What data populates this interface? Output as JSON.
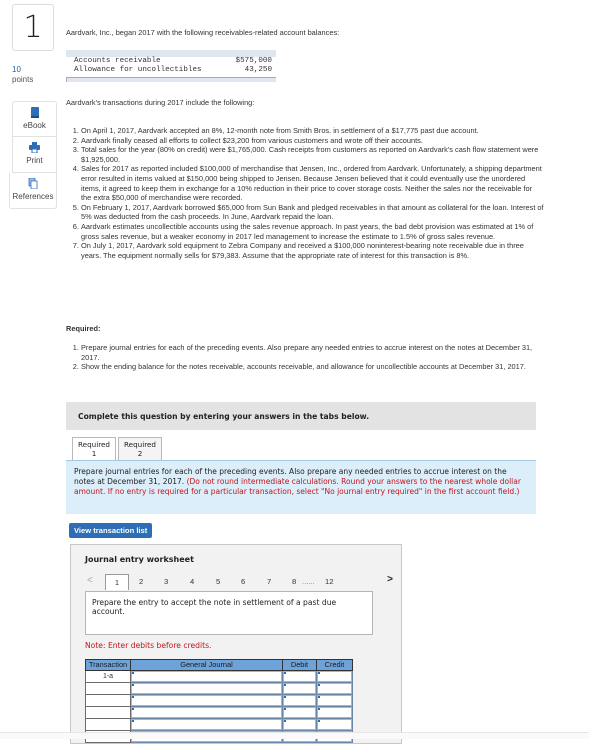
{
  "question": {
    "number": "1",
    "points_value": "10",
    "points_label": "points"
  },
  "side_tools": [
    {
      "label": "eBook",
      "icon": "book-icon"
    },
    {
      "label": "Print",
      "icon": "printer-icon"
    },
    {
      "label": "References",
      "icon": "documents-icon"
    }
  ],
  "intro": "Aardvark, Inc., began 2017 with the following receivables-related account balances:",
  "balances": [
    {
      "account": "Accounts receivable",
      "amount": "$575,000"
    },
    {
      "account": "Allowance for uncollectibles",
      "amount": "43,250"
    }
  ],
  "transactions_intro": "Aardvark's transactions during 2017 include the following:",
  "transactions": [
    "On April 1, 2017, Aardvark accepted an 8%, 12-month note from Smith Bros. in settlement of a $17,775 past due account.",
    "Aardvark finally ceased all efforts to collect $23,200 from various customers and wrote off their accounts.",
    "Total sales for the year (80% on credit) were $1,765,000. Cash receipts from customers as reported on Aardvark's cash flow statement were $1,925,000.",
    "Sales for 2017 as reported included $100,000 of merchandise that Jensen, Inc., ordered from Aardvark. Unfortunately, a shipping department error resulted in items valued at $150,000 being shipped to Jensen. Because Jensen believed that it could eventually use the unordered items, it agreed to keep them in exchange for a 10% reduction in their price to cover storage costs. Neither the sales nor the receivable for the extra $50,000 of merchandise were recorded.",
    "On February 1, 2017, Aardvark borrowed $65,000 from Sun Bank and pledged receivables in that amount as collateral for the loan. Interest of 5% was deducted from the cash proceeds. In June, Aardvark repaid the loan.",
    "Aardvark estimates uncollectible accounts using the sales revenue approach. In past years, the bad debt provision was estimated at 1% of gross sales revenue, but a weaker economy in 2017 led management to increase the estimate to 1.5% of gross sales revenue.",
    "On July 1, 2017, Aardvark sold equipment to Zebra Company and received a $100,000 noninterest-bearing note receivable due in three years. The equipment normally sells for $79,383. Assume that the appropriate rate of interest for this transaction is 8%."
  ],
  "required_heading": "Required:",
  "required_items": [
    "Prepare journal entries for each of the preceding events. Also prepare any needed entries to accrue interest on the notes at December 31, 2017.",
    "Show the ending balance for the notes receivable, accounts receivable, and allowance for uncollectible accounts at December 31, 2017."
  ],
  "complete_banner": "Complete this question by entering your answers in the tabs below.",
  "tabs": [
    {
      "line1": "Required",
      "line2": "1",
      "active": true
    },
    {
      "line1": "Required",
      "line2": "2",
      "active": false
    }
  ],
  "instructions": {
    "main": "Prepare journal entries for each of the preceding events. Also prepare any needed entries to accrue interest on the notes at December 31, 2017. ",
    "note_red": "(Do not round intermediate calculations. Round your answers to the nearest whole dollar amount. If no entry is required for a particular transaction, select \"No journal entry required\" in the first account field.)"
  },
  "view_transaction_button": "View transaction list",
  "worksheet": {
    "title": "Journal entry worksheet",
    "pages": [
      "1",
      "2",
      "3",
      "4",
      "5",
      "6",
      "7",
      "8"
    ],
    "ellipsis": "......",
    "last_page": "12",
    "active_page": "1",
    "prev_arrow": "<",
    "next_arrow": ">",
    "prompt": "Prepare the entry to accept the note in settlement of a past due account.",
    "note": "Note: Enter debits before credits.",
    "columns": [
      "Transaction",
      "General Journal",
      "Debit",
      "Credit"
    ],
    "rows": [
      {
        "transaction": "1-a",
        "account": "",
        "debit": "",
        "credit": ""
      },
      {
        "transaction": "",
        "account": "",
        "debit": "",
        "credit": ""
      },
      {
        "transaction": "",
        "account": "",
        "debit": "",
        "credit": ""
      },
      {
        "transaction": "",
        "account": "",
        "debit": "",
        "credit": ""
      },
      {
        "transaction": "",
        "account": "",
        "debit": "",
        "credit": ""
      },
      {
        "transaction": "",
        "account": "",
        "debit": "",
        "credit": ""
      }
    ]
  },
  "colors": {
    "link_blue": "#2a5d9f",
    "button_blue": "#2d6eb6",
    "header_blue": "#6ea3d9",
    "instruction_bg": "#dbeefa",
    "alert_red": "#c3161c"
  }
}
